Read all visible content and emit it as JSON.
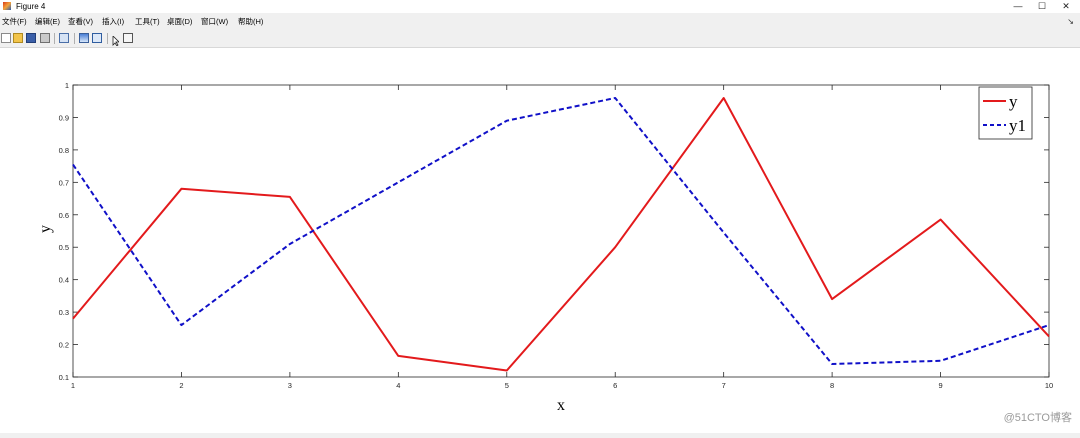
{
  "window": {
    "title": "Figure 4",
    "minimize": "—",
    "maximize": "☐",
    "close": "✕"
  },
  "menu": {
    "items": [
      "文件(F)",
      "编辑(E)",
      "查看(V)",
      "插入(I)",
      "工具(T)",
      "桌面(D)",
      "窗口(W)",
      "帮助(H)"
    ],
    "pin": "↘"
  },
  "toolbar": {
    "icons": [
      "new-figure-icon",
      "open-file-icon",
      "save-icon",
      "print-icon",
      "link-plot-icon",
      "colorbar-icon",
      "legend-icon",
      "pointer-icon",
      "plot-tools-icon"
    ]
  },
  "chart_data": {
    "type": "line",
    "x": [
      1,
      2,
      3,
      4,
      5,
      6,
      7,
      8,
      9,
      10
    ],
    "series": [
      {
        "name": "y",
        "color": "#e31a1c",
        "style": "solid",
        "values": [
          0.28,
          0.68,
          0.655,
          0.165,
          0.12,
          0.5,
          0.96,
          0.34,
          0.585,
          0.225
        ]
      },
      {
        "name": "y1",
        "color": "#1010c8",
        "style": "dashed",
        "values": [
          0.755,
          0.26,
          0.51,
          0.7,
          0.89,
          0.96,
          0.545,
          0.14,
          0.15,
          0.26
        ]
      }
    ],
    "xlabel": "x",
    "ylabel": "y",
    "xlim": [
      1,
      10
    ],
    "ylim": [
      0.1,
      1
    ],
    "xticks": [
      "1",
      "2",
      "3",
      "4",
      "5",
      "6",
      "7",
      "8",
      "9",
      "10"
    ],
    "yticks": [
      "0.1",
      "0.2",
      "0.3",
      "0.4",
      "0.5",
      "0.6",
      "0.7",
      "0.8",
      "0.9",
      "1"
    ],
    "grid": false,
    "legend": "top-right",
    "legend_labels": [
      "y",
      "y1"
    ]
  },
  "watermark": "@51CTO博客"
}
